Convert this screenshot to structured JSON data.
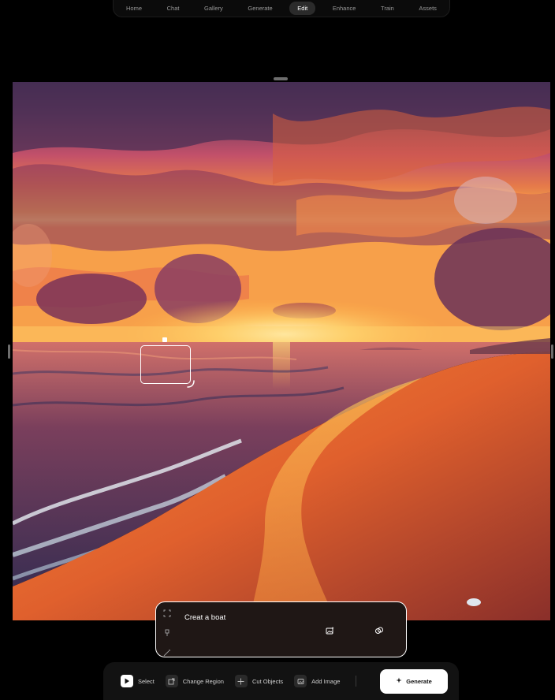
{
  "nav": {
    "items": [
      {
        "label": "Home",
        "active": false
      },
      {
        "label": "Chat",
        "active": false
      },
      {
        "label": "Gallery",
        "active": false
      },
      {
        "label": "Generate",
        "active": false
      },
      {
        "label": "Edit",
        "active": true
      },
      {
        "label": "Enhance",
        "active": false
      },
      {
        "label": "Train",
        "active": false
      },
      {
        "label": "Assets",
        "active": false
      }
    ]
  },
  "canvas": {
    "image": "sunset-beach-scene"
  },
  "prompt": {
    "value": "Creat a boat",
    "tools": [
      "region-select-icon",
      "brush-icon",
      "magic-wand-icon"
    ],
    "actions": [
      "add-image-icon",
      "blend-icon"
    ]
  },
  "toolbar": {
    "select_label": "Select",
    "change_region_label": "Change Region",
    "cut_objects_label": "Cut Objects",
    "add_image_label": "Add Image",
    "generate_label": "Generate"
  },
  "colors": {
    "background": "#000000",
    "panel": "#1f1715",
    "accent": "#ffffff"
  }
}
